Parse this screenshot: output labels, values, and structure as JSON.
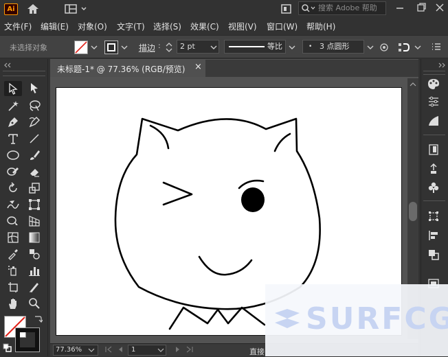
{
  "app": {
    "logo_text": "Ai",
    "search_placeholder": "搜索 Adobe 帮助"
  },
  "menu": [
    "文件(F)",
    "编辑(E)",
    "对象(O)",
    "文字(T)",
    "选择(S)",
    "效果(C)",
    "视图(V)",
    "窗口(W)",
    "帮助(H)"
  ],
  "control": {
    "selection_label": "未选择对象",
    "stroke_label": "描边",
    "stroke_value": "2 pt",
    "profile_label": "等比",
    "brush_label": "3 点圆形"
  },
  "document": {
    "tab_title": "未标题-1* @ 77.36% (RGB/预览)",
    "close_glyph": "×"
  },
  "status": {
    "zoom": "77.36%",
    "page": "1",
    "mode_label": "直接"
  },
  "watermark": {
    "text": "SURFCG"
  },
  "colors": {
    "accent_logo": "#ff9a00",
    "ui_bg": "#323232",
    "artboard": "#ffffff"
  },
  "icons": {
    "home": "home-icon",
    "workspace": "workspace-icon",
    "search": "search-icon",
    "selection": "selection-tool-icon",
    "direct_selection": "direct-selection-tool-icon"
  }
}
